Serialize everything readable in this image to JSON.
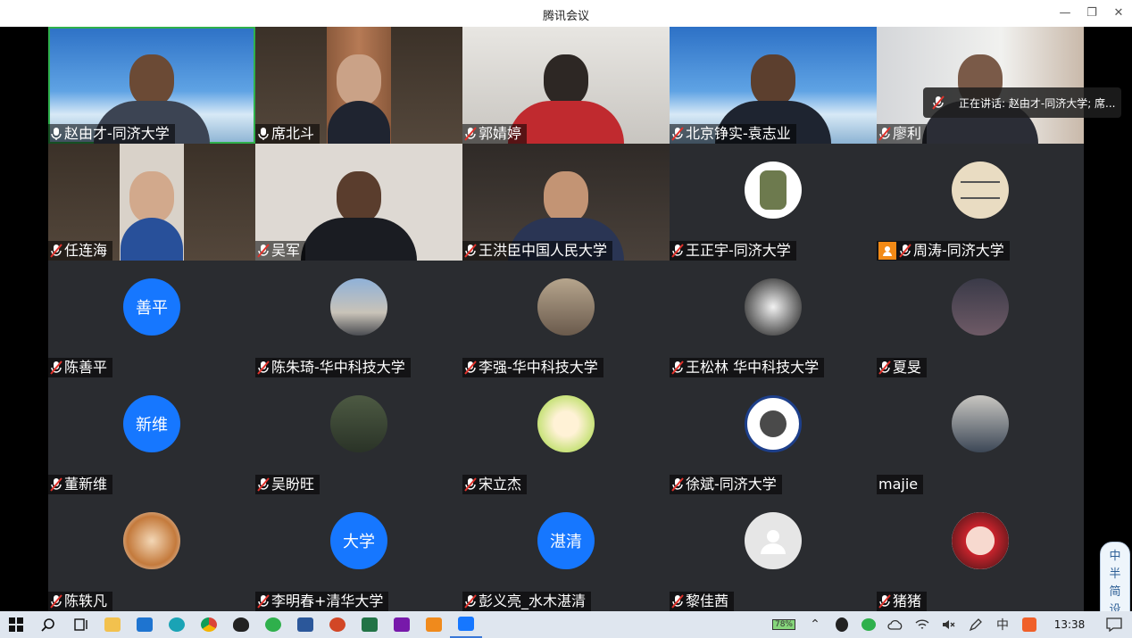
{
  "window": {
    "title": "腾讯会议"
  },
  "speaking": {
    "text": "正在讲话: 赵由才-同济大学; 席..."
  },
  "tiles": [
    {
      "name": "赵由才-同济大学",
      "mic": "on"
    },
    {
      "name": "席北斗",
      "mic": "on"
    },
    {
      "name": "郭婧婷",
      "mic": "muted"
    },
    {
      "name": "北京铮实-袁志业",
      "mic": "muted"
    },
    {
      "name": "廖利",
      "mic": "muted"
    },
    {
      "name": "任连海",
      "mic": "muted"
    },
    {
      "name": "吴军",
      "mic": "muted"
    },
    {
      "name": "王洪臣中国人民大学",
      "mic": "muted"
    },
    {
      "name": "王正宇-同济大学",
      "mic": "muted"
    },
    {
      "name": "周涛-同济大学",
      "mic": "muted"
    },
    {
      "name": "陈善平",
      "mic": "muted",
      "avatar_text": "善平"
    },
    {
      "name": "陈朱琦-华中科技大学",
      "mic": "muted"
    },
    {
      "name": "李强-华中科技大学",
      "mic": "muted"
    },
    {
      "name": "王松林 华中科技大学",
      "mic": "muted"
    },
    {
      "name": "夏旻",
      "mic": "muted"
    },
    {
      "name": "董新维",
      "mic": "muted",
      "avatar_text": "新维"
    },
    {
      "name": "吴盼旺",
      "mic": "muted"
    },
    {
      "name": "宋立杰",
      "mic": "muted"
    },
    {
      "name": "徐斌-同济大学",
      "mic": "muted"
    },
    {
      "name": "majie",
      "mic": "none"
    },
    {
      "name": "陈轶凡",
      "mic": "muted"
    },
    {
      "name": "李明春+清华大学",
      "mic": "muted",
      "avatar_text": "大学"
    },
    {
      "name": "彭义亮_水木湛清",
      "mic": "muted",
      "avatar_text": "湛清"
    },
    {
      "name": "黎佳茜",
      "mic": "muted"
    },
    {
      "name": "猪猪",
      "mic": "muted"
    }
  ],
  "ime": {
    "chars": [
      "中",
      "半",
      "简",
      "设"
    ]
  },
  "taskbar": {
    "battery": "78%",
    "ime_lang": "中",
    "clock": "13:38"
  },
  "colors": {
    "accent": "#1677ff",
    "active_speaker": "#2fb04c",
    "mute_red": "#e0322b"
  }
}
